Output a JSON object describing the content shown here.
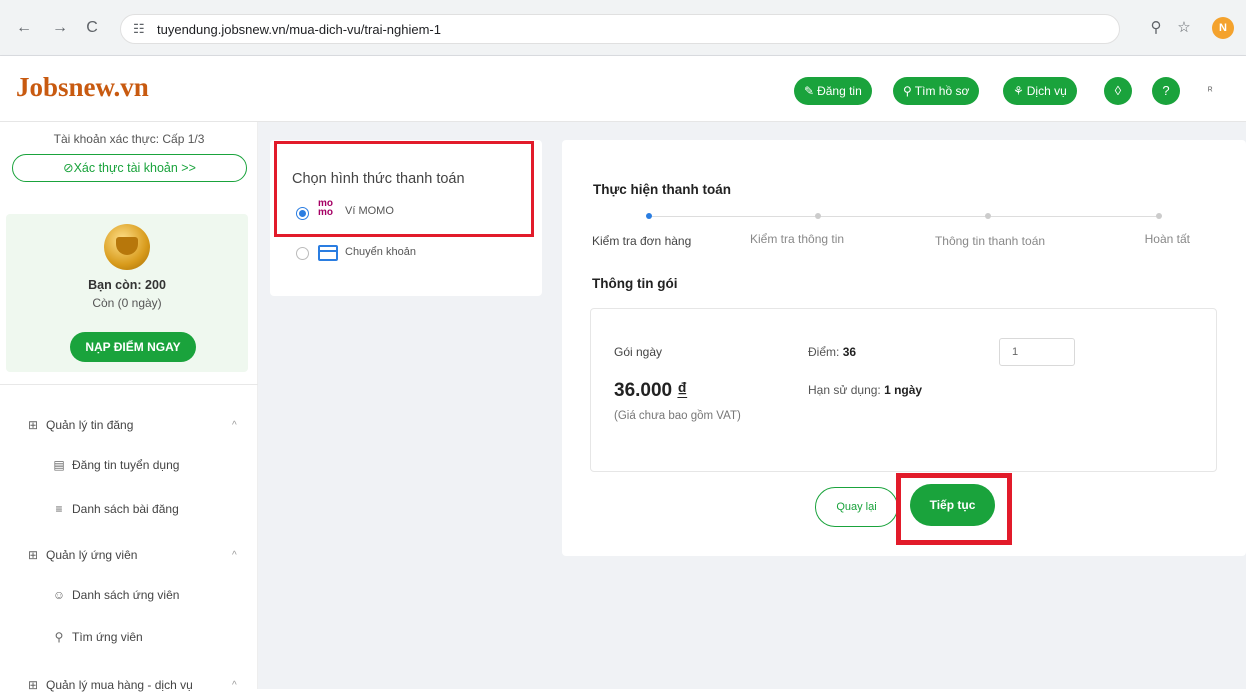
{
  "browser": {
    "back": "←",
    "forward": "→",
    "reload": "C",
    "site_icon": "☷",
    "url": "tuyendung.jobsnew.vn/mua-dich-vu/trai-nghiem-1",
    "zoom_icon": "⚲",
    "star_icon": "☆",
    "profile_initial": "N"
  },
  "header": {
    "logo": "Jobsnew.vn",
    "buttons": [
      {
        "icon": "✎",
        "label": "Đăng tin"
      },
      {
        "icon": "⚲",
        "label": "Tìm hồ sơ"
      },
      {
        "icon": "⚘",
        "label": "Dịch vụ"
      }
    ],
    "notify_icon": "◊",
    "help_icon": "?",
    "end_text": "ᴿ"
  },
  "sidebar": {
    "account_level": "Tài khoản xác thực: Cấp 1/3",
    "verify_button": "Xác thực tài khoản >>",
    "points": "Bạn còn: 200",
    "days": "Còn (0 ngày)",
    "topup_button": "NẠP ĐIỂM NGAY",
    "menu": [
      {
        "label": "Quản lý tin đăng",
        "icon": "⊞"
      },
      {
        "label": "Đăng tin tuyển dụng",
        "icon": "▤"
      },
      {
        "label": "Danh sách bài đăng",
        "icon": "≡"
      },
      {
        "label": "Quản lý ứng viên",
        "icon": "⊞"
      },
      {
        "label": "Danh sách ứng viên",
        "icon": "☺"
      },
      {
        "label": "Tìm ứng viên",
        "icon": "⚲"
      },
      {
        "label": "Quản lý mua hàng - dịch vụ",
        "icon": "⊞"
      }
    ],
    "caret": "^"
  },
  "payment": {
    "title": "Chọn hình thức thanh toán",
    "options": [
      {
        "logo": "mo mo",
        "label": "Ví MOMO",
        "selected": true
      },
      {
        "label": "Chuyển khoản",
        "selected": false
      }
    ]
  },
  "checkout": {
    "title": "Thực hiện thanh toán",
    "steps": [
      {
        "label": "Kiểm tra đơn hàng",
        "active": true
      },
      {
        "label": "Kiểm tra thông tin",
        "active": false
      },
      {
        "label": "Thông tin thanh toán",
        "active": false
      },
      {
        "label": "Hoàn tất",
        "active": false
      }
    ],
    "package_title": "Thông tin gói",
    "package": {
      "name": "Gói ngày",
      "price": "36.000",
      "currency": "₫",
      "vat_note": "(Giá chưa bao gồm VAT)",
      "points_label": "Điểm:",
      "points_value": "36",
      "expire_label": "Hạn sử dụng:",
      "expire_value": "1 ngày",
      "quantity": "1"
    },
    "back_button": "Quay lại",
    "continue_button": "Tiếp tục"
  },
  "colors": {
    "brand_green": "#1aa33c",
    "logo_orange": "#c85a10",
    "highlight_red": "#e21b2a",
    "momo_pink": "#a50064"
  }
}
